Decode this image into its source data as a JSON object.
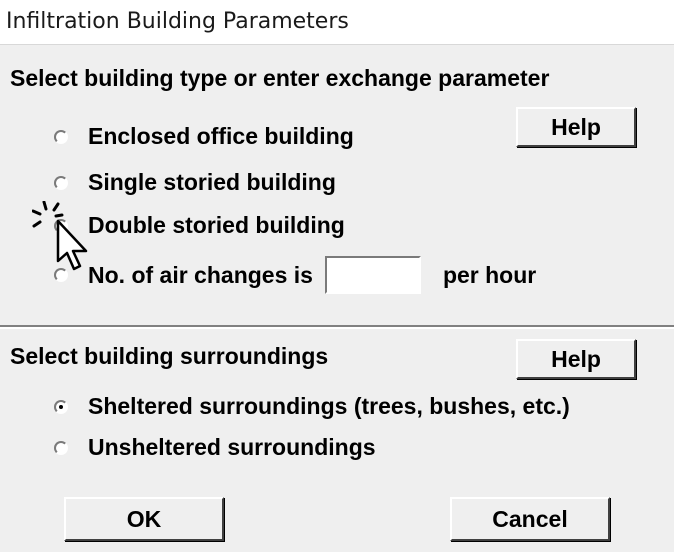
{
  "window": {
    "title": "Infiltration Building Parameters"
  },
  "building_type": {
    "heading": "Select building type or enter exchange parameter",
    "help_label": "Help",
    "options": [
      {
        "label": "Enclosed office building",
        "selected": false
      },
      {
        "label": "Single storied building",
        "selected": false
      },
      {
        "label": "Double storied building",
        "selected": false
      },
      {
        "label": "No. of air changes is",
        "selected": false
      }
    ],
    "air_changes_value": "",
    "air_changes_unit": "per hour"
  },
  "surroundings": {
    "heading": "Select building surroundings",
    "help_label": "Help",
    "options": [
      {
        "label": "Sheltered surroundings (trees, bushes, etc.)",
        "selected": true
      },
      {
        "label": "Unsheltered surroundings",
        "selected": false
      }
    ]
  },
  "footer": {
    "ok_label": "OK",
    "cancel_label": "Cancel"
  },
  "icons": {
    "cursor": "mouse-pointer-click-icon"
  }
}
